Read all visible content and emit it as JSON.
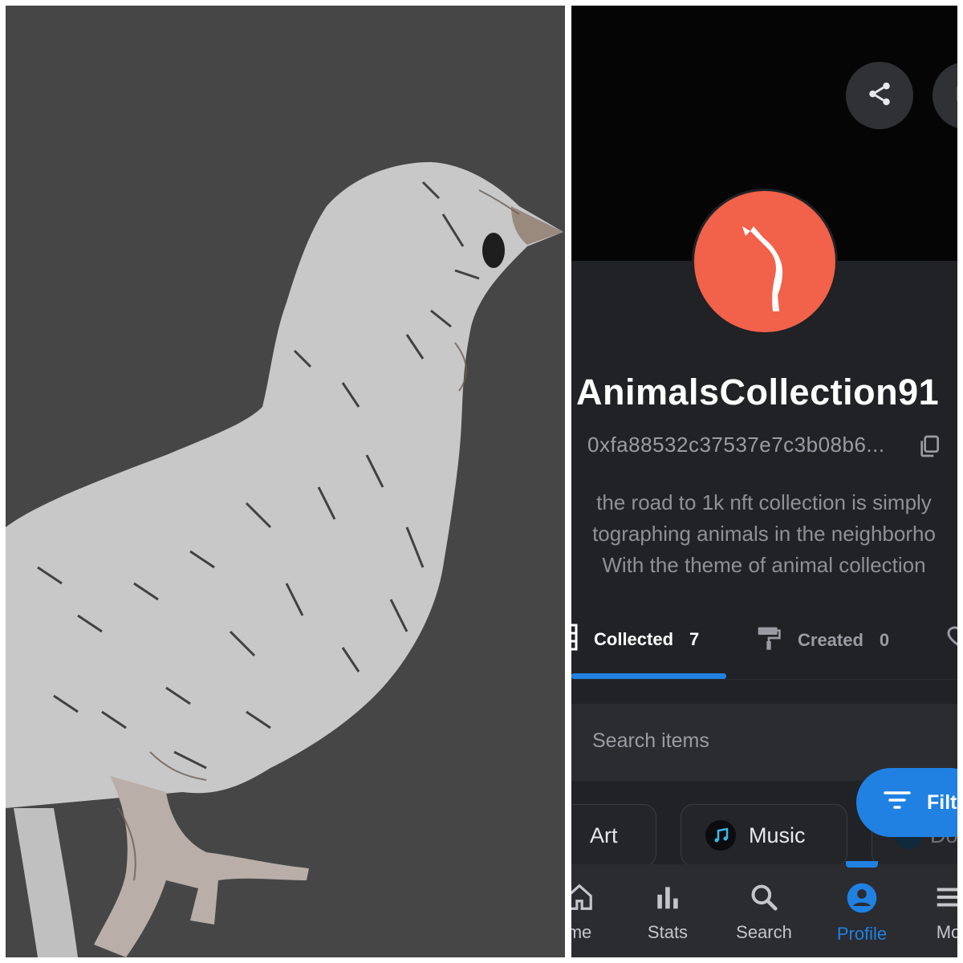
{
  "profile": {
    "username": "AnimalsCollection91",
    "address": "0xfa88532c37537e7c3b08b6...",
    "bio_lines": [
      "the road to 1k nft collection is simply",
      "tographing animals in the neighborho",
      "With the theme of animal collection"
    ]
  },
  "tabs": [
    {
      "label": "Collected",
      "count": "7",
      "icon": "grid-icon",
      "active": true
    },
    {
      "label": "Created",
      "count": "0",
      "icon": "paint-roller-icon",
      "active": false
    }
  ],
  "search": {
    "placeholder": "Search items"
  },
  "filter": {
    "label": "Filt"
  },
  "chips": [
    {
      "label": "Art",
      "icon": "art-icon"
    },
    {
      "label": "Music",
      "icon": "music-note-icon"
    },
    {
      "label": "Do",
      "icon": "domain-icon"
    }
  ],
  "nav": [
    {
      "label": "me",
      "icon": "home-icon"
    },
    {
      "label": "Stats",
      "icon": "bar-chart-icon"
    },
    {
      "label": "Search",
      "icon": "search-icon"
    },
    {
      "label": "Profile",
      "icon": "profile-icon",
      "active": true
    },
    {
      "label": "Mo",
      "icon": "menu-icon"
    }
  ],
  "colors": {
    "accent": "#2081e2",
    "avatar_bg": "#f2614a",
    "panel_bg": "#202225",
    "photo_bg": "#464646"
  }
}
